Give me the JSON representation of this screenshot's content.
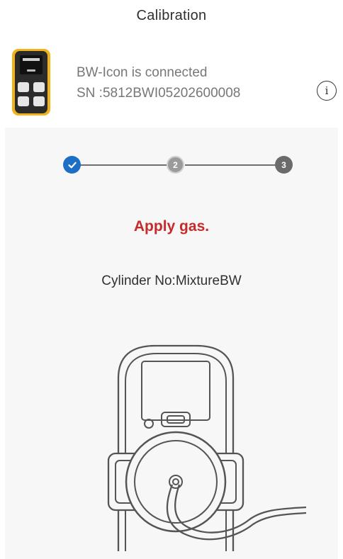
{
  "header": {
    "title": "Calibration"
  },
  "device": {
    "status": "BW-Icon is connected",
    "serial": "SN :5812BWI05202600008",
    "info_icon": "info-icon",
    "info_glyph": "i"
  },
  "stepper": {
    "steps": [
      {
        "label": "",
        "state": "completed",
        "icon": "check-icon"
      },
      {
        "label": "2",
        "state": "active"
      },
      {
        "label": "3",
        "state": "pending"
      }
    ]
  },
  "main": {
    "instruction": "Apply gas.",
    "cylinder": "Cylinder No:MixtureBW"
  },
  "colors": {
    "accent_blue": "#1c6fc4",
    "warning_red": "#c62a2a",
    "device_yellow": "#f2b21b"
  }
}
